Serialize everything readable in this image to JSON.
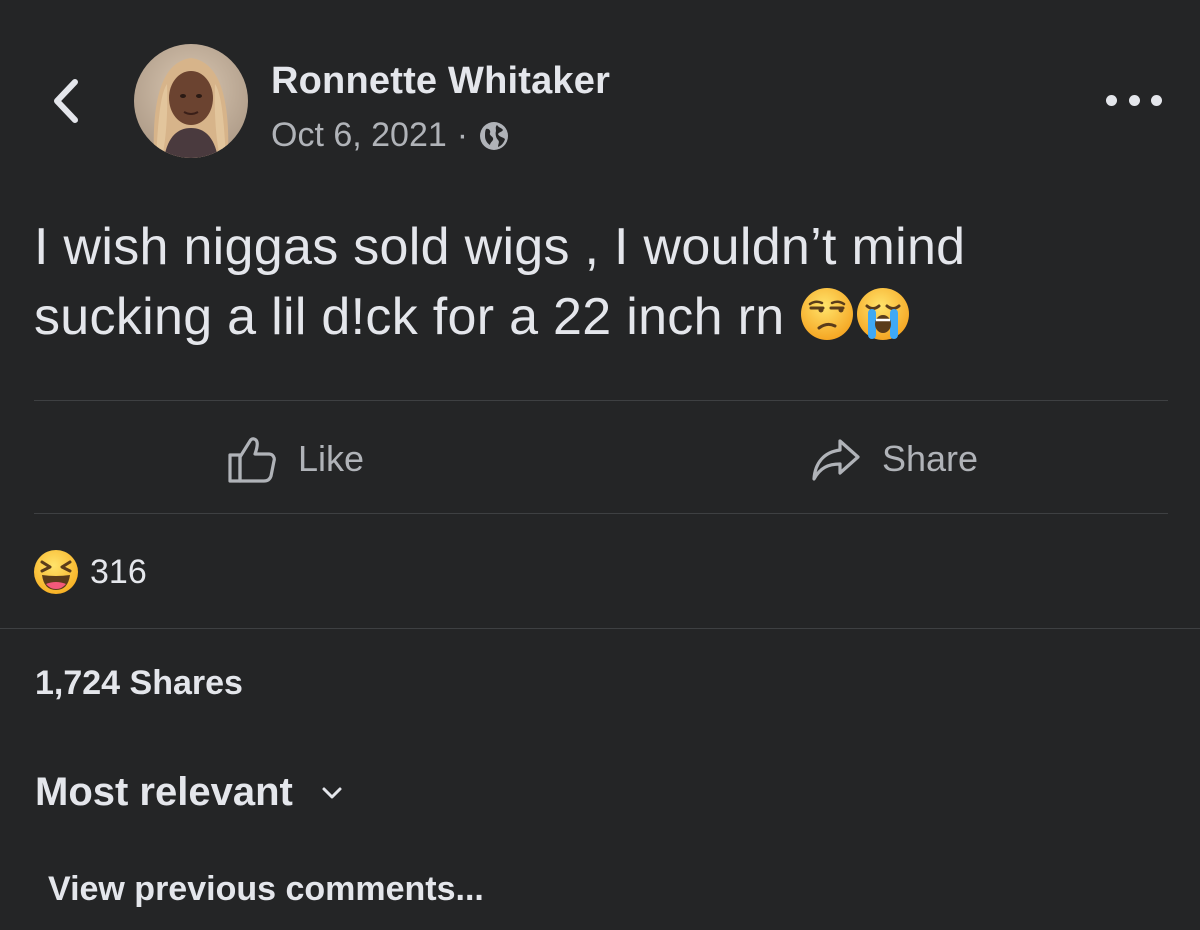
{
  "header": {
    "back_icon": "chevron-left-icon",
    "author_name": "Ronnette Whitaker",
    "date": "Oct 6, 2021",
    "separator": "·",
    "privacy_icon": "globe-icon",
    "more_icon": "more-horizontal-icon"
  },
  "post": {
    "line1": "I wish niggas sold wigs , I wouldn’t mind",
    "line2": "sucking a lil d!ck for a 22 inch rn",
    "emojis": [
      "unamused-face-emoji",
      "loudly-crying-face-emoji"
    ]
  },
  "actions": {
    "like_label": "Like",
    "like_icon": "thumbs-up-icon",
    "share_label": "Share",
    "share_icon": "share-arrow-icon"
  },
  "reactions": {
    "icon": "laughing-face-emoji",
    "count": "316"
  },
  "shares": {
    "text": "1,724 Shares"
  },
  "comments": {
    "sort_label": "Most relevant",
    "sort_icon": "chevron-down-icon",
    "view_previous": "View previous comments..."
  },
  "colors": {
    "background": "#242526",
    "primary_text": "#e4e6eb",
    "secondary_text": "#b0b3b8",
    "divider": "#3e4042"
  }
}
